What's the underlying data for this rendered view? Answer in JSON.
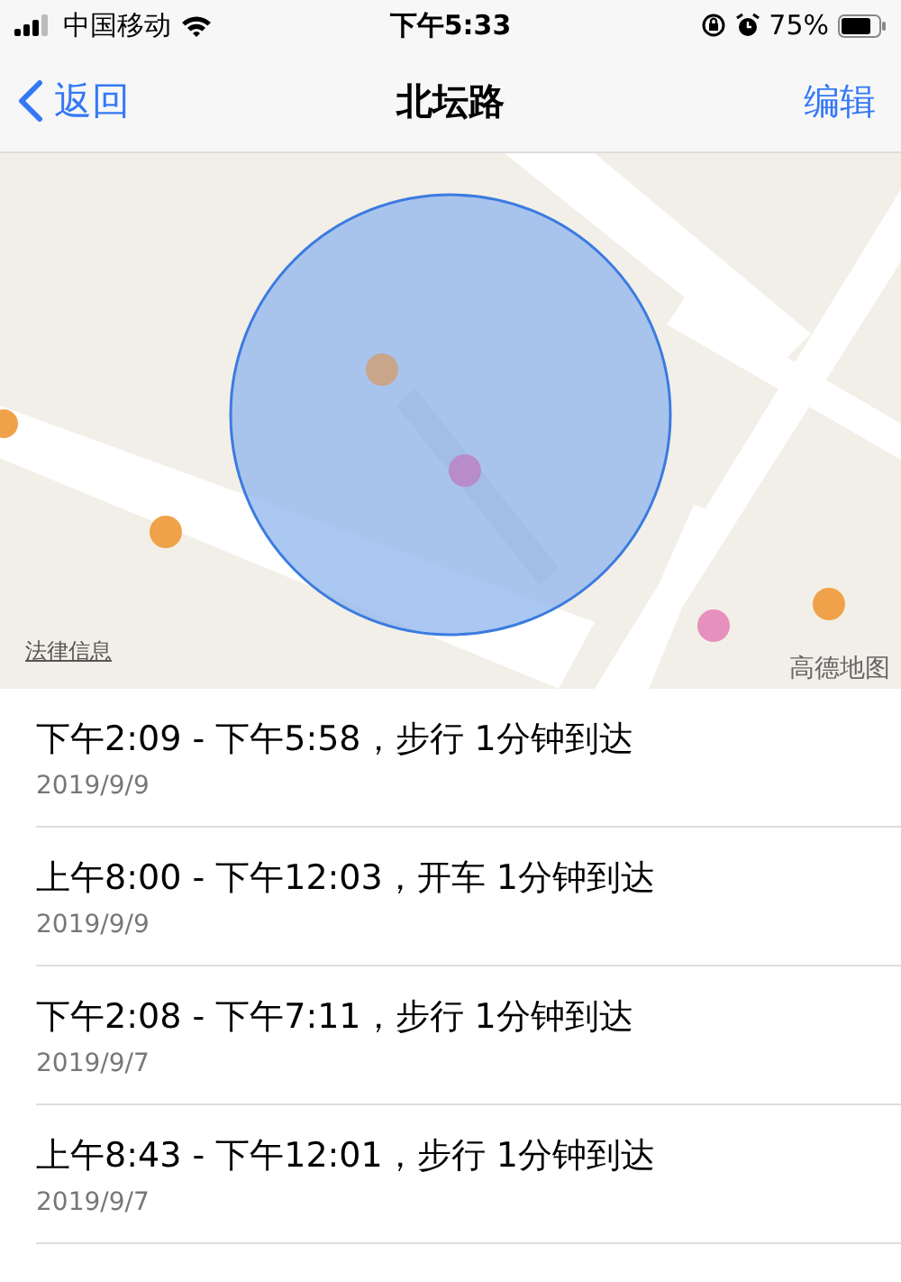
{
  "status_bar": {
    "carrier": "中国移动",
    "time": "下午5:33",
    "battery": "75%"
  },
  "nav": {
    "back": "返回",
    "title": "北坛路",
    "action": "编辑"
  },
  "map": {
    "kind": "picture",
    "legal_link": "法律信息",
    "provider": "高德地图"
  },
  "visits": [
    {
      "time": "下午2:09 - 下午5:58，步行 1分钟到达",
      "date": "2019/9/9"
    },
    {
      "time": "上午8:00 - 下午12:03，开车 1分钟到达",
      "date": "2019/9/9"
    },
    {
      "time": "下午2:08 - 下午7:11，步行 1分钟到达",
      "date": "2019/9/7"
    },
    {
      "time": "上午8:43 - 下午12:01，步行 1分钟到达",
      "date": "2019/9/7"
    }
  ]
}
